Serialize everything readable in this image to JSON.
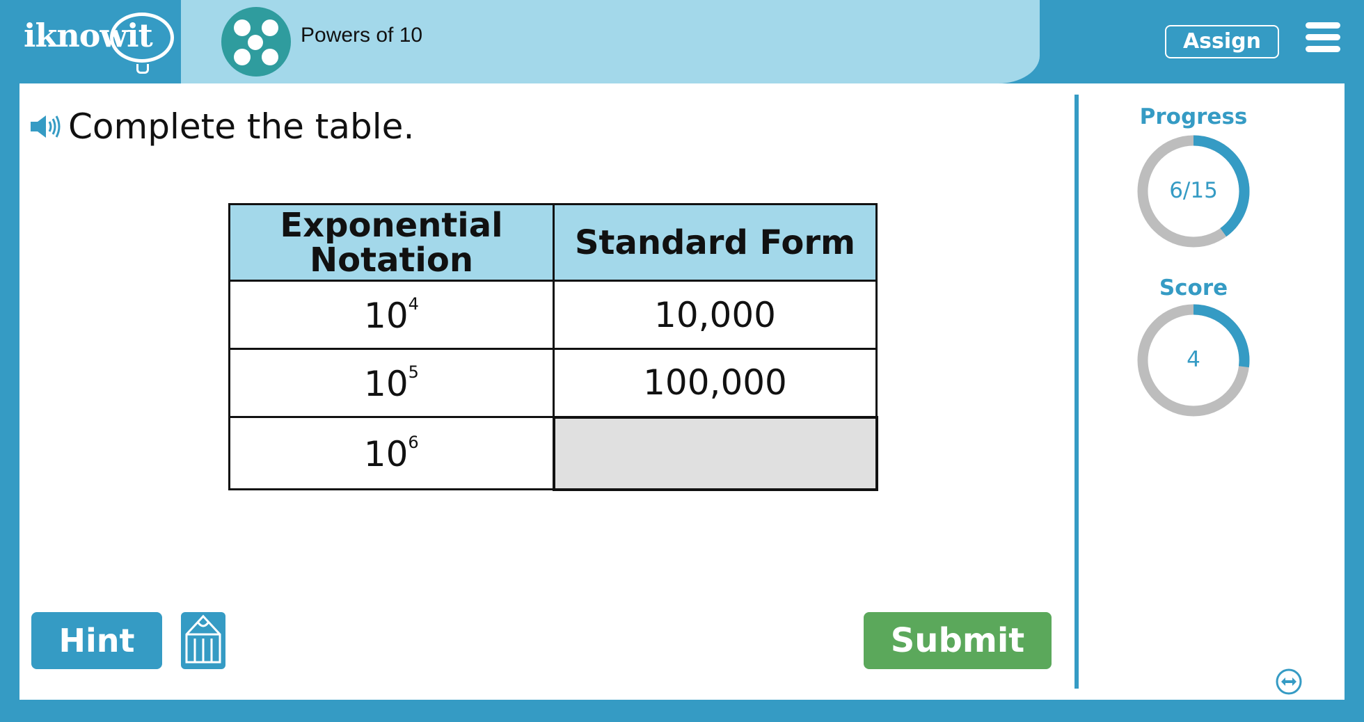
{
  "header": {
    "logo_text": "iknowit",
    "topic_title": "Powers of 10",
    "assign_label": "Assign"
  },
  "question": {
    "prompt": "Complete the table."
  },
  "table": {
    "headers": [
      "Exponential Notation",
      "Standard Form"
    ],
    "header_col1_line1": "Exponential",
    "header_col1_line2": "Notation",
    "rows": [
      {
        "base": "10",
        "exponent": "4",
        "standard": "10,000"
      },
      {
        "base": "10",
        "exponent": "5",
        "standard": "100,000"
      },
      {
        "base": "10",
        "exponent": "6",
        "standard": ""
      }
    ]
  },
  "buttons": {
    "hint_label": "Hint",
    "submit_label": "Submit"
  },
  "sidebar": {
    "progress_label": "Progress",
    "progress_value": "6/15",
    "progress_fraction": 0.4,
    "score_label": "Score",
    "score_value": "4",
    "score_fraction": 0.27
  },
  "colors": {
    "brand_blue": "#359bc4",
    "light_blue": "#a3d8ea",
    "submit_green": "#5ba85b",
    "ring_gray": "#bdbdbd"
  },
  "icons": [
    "speaker-icon",
    "pencil-icon",
    "menu-icon",
    "expand-icon",
    "topic-dots-icon"
  ]
}
